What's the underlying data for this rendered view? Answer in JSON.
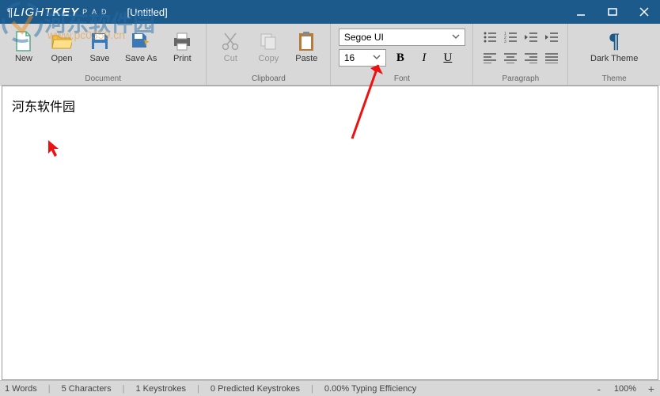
{
  "title": {
    "brand": "LIGHT",
    "brand2": "KEY",
    "pad": "P A D",
    "document": "[Untitled]"
  },
  "ribbon": {
    "document": {
      "label": "Document",
      "new": "New",
      "open": "Open",
      "save": "Save",
      "saveas": "Save As",
      "print": "Print"
    },
    "clipboard": {
      "label": "Clipboard",
      "cut": "Cut",
      "copy": "Copy",
      "paste": "Paste"
    },
    "font": {
      "label": "Font",
      "family": "Segoe UI",
      "size": "16",
      "B": "B",
      "I": "I",
      "U": "U"
    },
    "paragraph": {
      "label": "Paragraph"
    },
    "theme": {
      "label": "Theme",
      "dark": "Dark Theme"
    }
  },
  "editor": {
    "text": "河东软件园"
  },
  "status": {
    "words": "1 Words",
    "chars": "5 Characters",
    "keys": "1 Keystrokes",
    "predicted": "0 Predicted Keystrokes",
    "eff": "0.00% Typing Efficiency",
    "zoom": "100%"
  },
  "watermark": {
    "text": "河东软件园",
    "url": "www.pc0359.cn"
  }
}
